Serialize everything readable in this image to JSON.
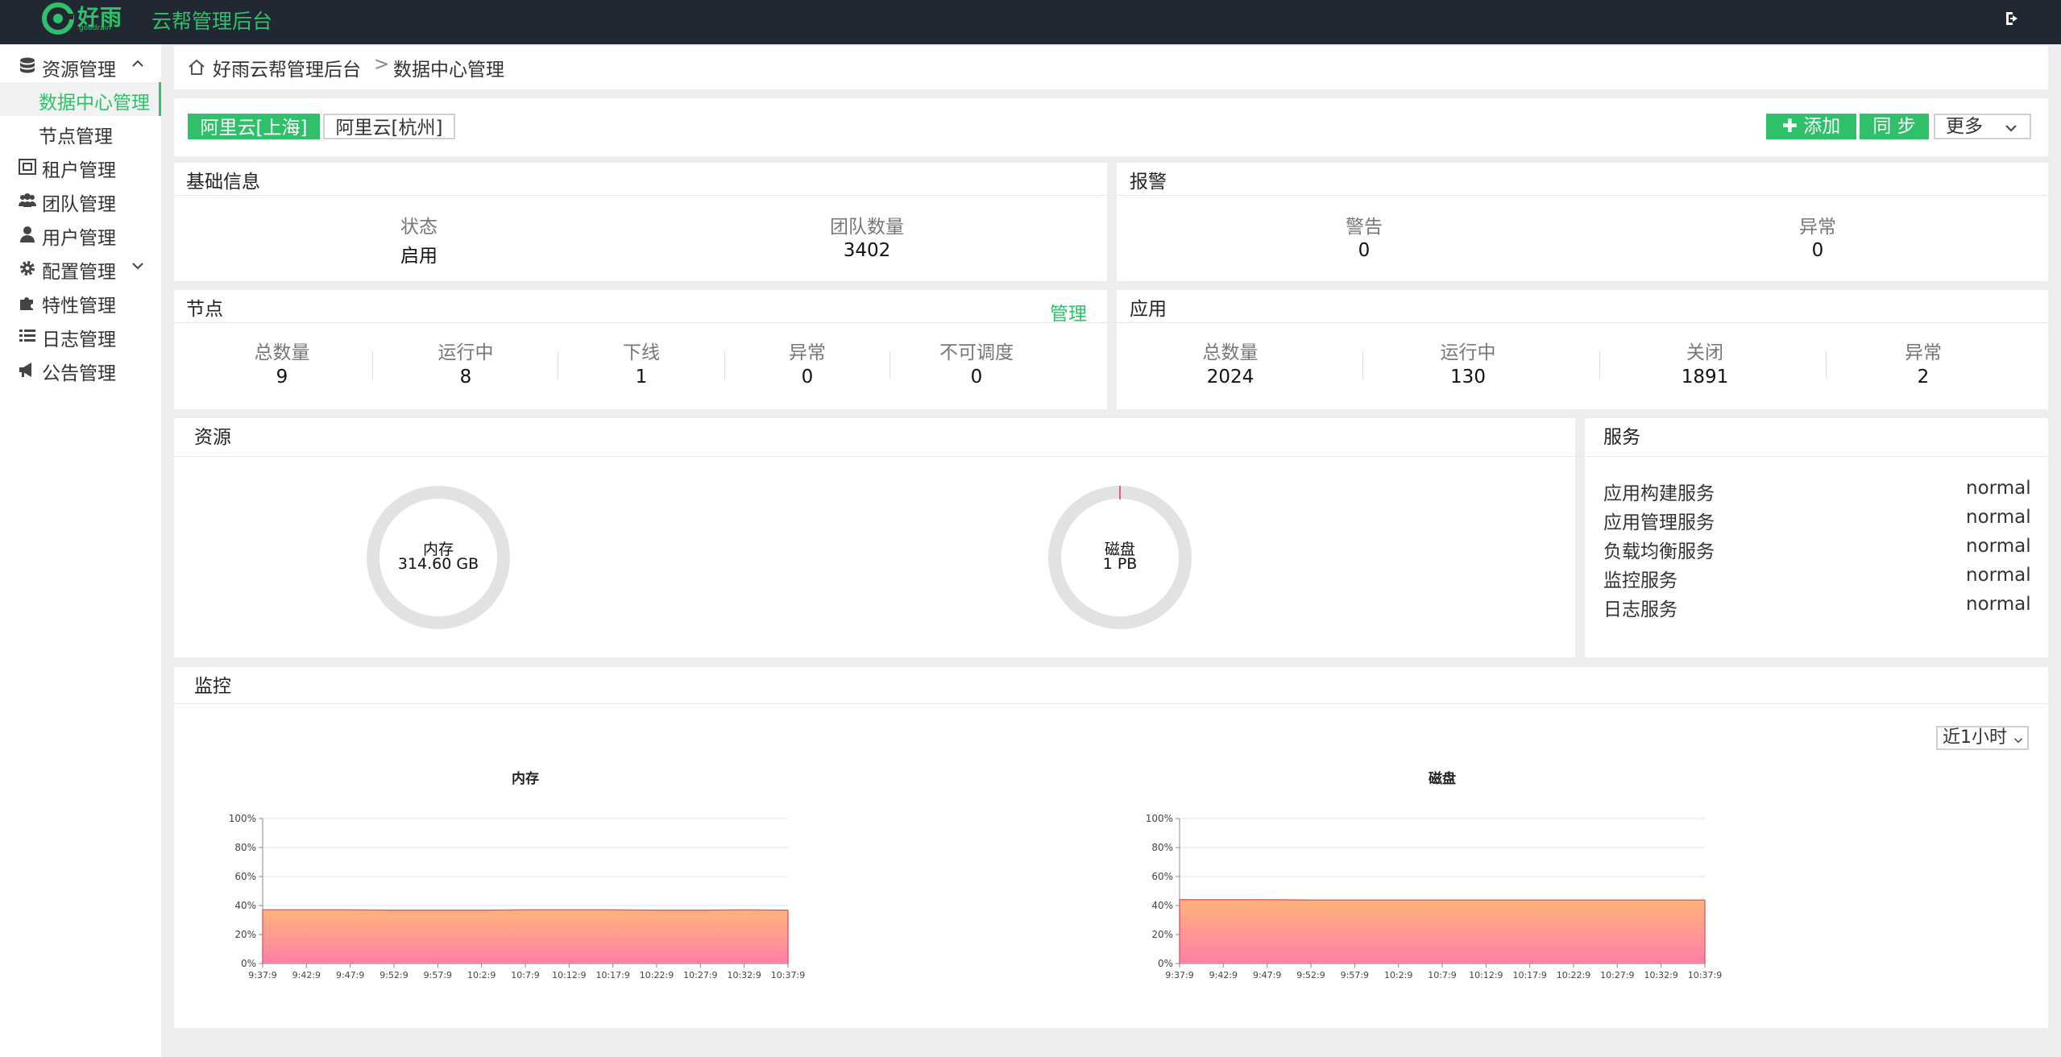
{
  "header": {
    "logo_text": "好雨",
    "logo_sub": "goodrain",
    "app_title": "云帮管理后台",
    "logout_icon": "logout-icon"
  },
  "sidebar": {
    "groups": [
      {
        "label": "资源管理",
        "icon": "database-icon",
        "expanded": true
      },
      {
        "label": "租户管理",
        "icon": "tenant-icon"
      },
      {
        "label": "团队管理",
        "icon": "team-icon"
      },
      {
        "label": "用户管理",
        "icon": "user-icon"
      },
      {
        "label": "配置管理",
        "icon": "gear-icon",
        "expanded": false
      },
      {
        "label": "特性管理",
        "icon": "puzzle-icon"
      },
      {
        "label": "日志管理",
        "icon": "list-icon"
      },
      {
        "label": "公告管理",
        "icon": "bullhorn-icon"
      }
    ],
    "sub_items": [
      {
        "label": "数据中心管理",
        "active": true
      },
      {
        "label": "节点管理",
        "active": false
      }
    ]
  },
  "breadcrumb": {
    "home": "好雨云帮管理后台",
    "sep": ">",
    "current": "数据中心管理"
  },
  "toolbar": {
    "tabs": [
      {
        "label": "阿里云[上海]",
        "active": true
      },
      {
        "label": "阿里云[杭州]",
        "active": false
      }
    ],
    "add_label": "✚ 添加",
    "sync_label": "同 步",
    "more_label": "更多"
  },
  "basic_info": {
    "title": "基础信息",
    "status_label": "状态",
    "status_value": "启用",
    "teams_label": "团队数量",
    "teams_value": "3402"
  },
  "alarm": {
    "title": "报警",
    "warn_label": "警告",
    "warn_value": "0",
    "error_label": "异常",
    "error_value": "0"
  },
  "nodes": {
    "title": "节点",
    "manage_label": "管理",
    "stats": [
      {
        "label": "总数量",
        "value": "9"
      },
      {
        "label": "运行中",
        "value": "8"
      },
      {
        "label": "下线",
        "value": "1"
      },
      {
        "label": "异常",
        "value": "0"
      },
      {
        "label": "不可调度",
        "value": "0"
      }
    ]
  },
  "apps": {
    "title": "应用",
    "stats": [
      {
        "label": "总数量",
        "value": "2024"
      },
      {
        "label": "运行中",
        "value": "130"
      },
      {
        "label": "关闭",
        "value": "1891"
      },
      {
        "label": "异常",
        "value": "2"
      }
    ]
  },
  "resources": {
    "title": "资源",
    "memory": {
      "name": "内存",
      "value": "314.60 GB"
    },
    "disk": {
      "name": "磁盘",
      "value": "1 PB"
    }
  },
  "services": {
    "title": "服务",
    "items": [
      {
        "name": "应用构建服务",
        "status": "normal"
      },
      {
        "name": "应用管理服务",
        "status": "normal"
      },
      {
        "name": "负载均衡服务",
        "status": "normal"
      },
      {
        "name": "监控服务",
        "status": "normal"
      },
      {
        "name": "日志服务",
        "status": "normal"
      }
    ]
  },
  "monitor": {
    "title": "监控",
    "range_label": "近1小时"
  },
  "colors": {
    "accent": "#30c06a",
    "topbar": "#212833",
    "area_top": "#ffb37a",
    "area_bottom": "#ff7fa8",
    "area_line": "#e0607a"
  },
  "chart_data": [
    {
      "type": "area",
      "title": "内存",
      "x": [
        "9:37:9",
        "9:42:9",
        "9:47:9",
        "9:52:9",
        "9:57:9",
        "10:2:9",
        "10:7:9",
        "10:12:9",
        "10:17:9",
        "10:22:9",
        "10:27:9",
        "10:32:9",
        "10:37:9"
      ],
      "y_ticks": [
        "0%",
        "20%",
        "40%",
        "60%",
        "80%",
        "100%"
      ],
      "ylim": [
        0,
        100
      ],
      "values": [
        37,
        37,
        37,
        36.8,
        36.8,
        36.8,
        37,
        37,
        37,
        36.8,
        36.8,
        37,
        36.8
      ]
    },
    {
      "type": "area",
      "title": "磁盘",
      "x": [
        "9:37:9",
        "9:42:9",
        "9:47:9",
        "9:52:9",
        "9:57:9",
        "10:2:9",
        "10:7:9",
        "10:12:9",
        "10:17:9",
        "10:22:9",
        "10:27:9",
        "10:32:9",
        "10:37:9"
      ],
      "y_ticks": [
        "0%",
        "20%",
        "40%",
        "60%",
        "80%",
        "100%"
      ],
      "ylim": [
        0,
        100
      ],
      "values": [
        44,
        44,
        44,
        43.8,
        43.8,
        43.8,
        43.8,
        43.8,
        43.8,
        43.8,
        43.8,
        43.8,
        43.8
      ]
    }
  ]
}
